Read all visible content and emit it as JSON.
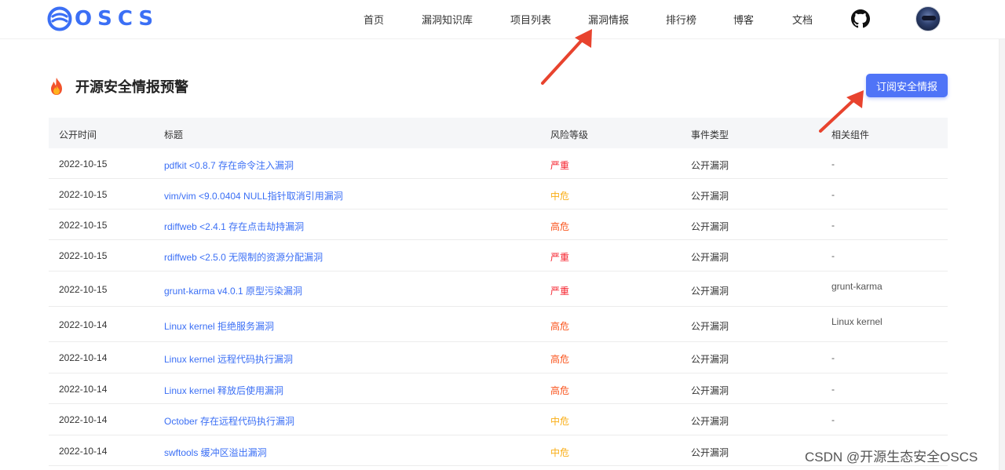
{
  "brand": {
    "name": "OSCS"
  },
  "nav": {
    "items": [
      "首页",
      "漏洞知识库",
      "项目列表",
      "漏洞情报",
      "排行榜",
      "博客",
      "文档"
    ]
  },
  "section": {
    "title": "开源安全情报预警",
    "subscribe_label": "订阅安全情报"
  },
  "table": {
    "headers": [
      "公开时间",
      "标题",
      "风险等级",
      "事件类型",
      "相关组件"
    ],
    "rows": [
      {
        "date": "2022-10-15",
        "title": "pdfkit <0.8.7 存在命令注入漏洞",
        "level": "严重",
        "type": "公开漏洞",
        "component": "-"
      },
      {
        "date": "2022-10-15",
        "title": "vim/vim <9.0.0404 NULL指针取消引用漏洞",
        "level": "中危",
        "type": "公开漏洞",
        "component": "-"
      },
      {
        "date": "2022-10-15",
        "title": "rdiffweb <2.4.1 存在点击劫持漏洞",
        "level": "高危",
        "type": "公开漏洞",
        "component": "-"
      },
      {
        "date": "2022-10-15",
        "title": "rdiffweb <2.5.0 无限制的资源分配漏洞",
        "level": "严重",
        "type": "公开漏洞",
        "component": "-"
      },
      {
        "date": "2022-10-15",
        "title": "grunt-karma v4.0.1 原型污染漏洞",
        "level": "严重",
        "type": "公开漏洞",
        "component": "grunt-karma"
      },
      {
        "date": "2022-10-14",
        "title": "Linux kernel 拒绝服务漏洞",
        "level": "高危",
        "type": "公开漏洞",
        "component": "Linux kernel"
      },
      {
        "date": "2022-10-14",
        "title": "Linux kernel 远程代码执行漏洞",
        "level": "高危",
        "type": "公开漏洞",
        "component": "-"
      },
      {
        "date": "2022-10-14",
        "title": "Linux kernel 释放后使用漏洞",
        "level": "高危",
        "type": "公开漏洞",
        "component": "-"
      },
      {
        "date": "2022-10-14",
        "title": "October 存在远程代码执行漏洞",
        "level": "中危",
        "type": "公开漏洞",
        "component": "-"
      },
      {
        "date": "2022-10-14",
        "title": "swftools 缓冲区溢出漏洞",
        "level": "中危",
        "type": "公开漏洞",
        "component": ""
      }
    ]
  },
  "level_colors": {
    "严重": "#f5222d",
    "高危": "#fa541c",
    "中危": "#faad14"
  },
  "colors": {
    "accent": "#3b6ff5",
    "button": "#4f74f7",
    "arrow": "#e8432e"
  },
  "icons": [
    "oscs-logo-icon",
    "github-icon",
    "user-avatar",
    "fire-icon"
  ],
  "watermark": "CSDN @开源生态安全OSCS"
}
